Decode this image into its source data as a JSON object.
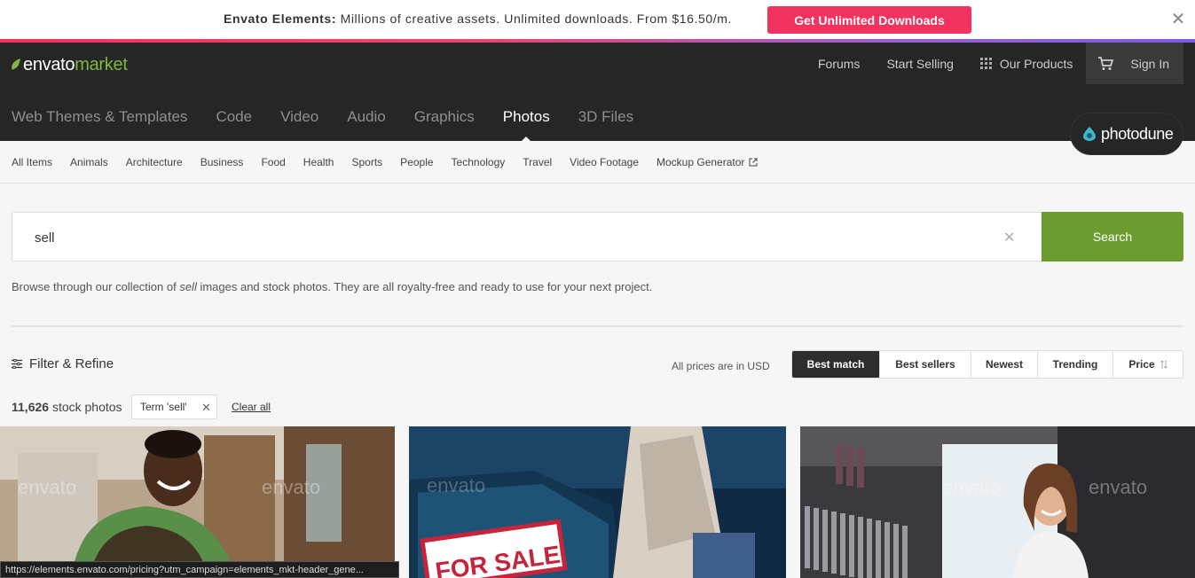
{
  "promo": {
    "brand": "Envato Elements:",
    "message": " Millions of creative assets. Unlimited downloads. From $16.50/m.",
    "cta": "Get Unlimited Downloads",
    "close": "✕"
  },
  "header": {
    "logo_envato": "envato",
    "logo_market": "market",
    "links": {
      "forums": "Forums",
      "start_selling": "Start Selling",
      "our_products": "Our Products",
      "sign_in": "Sign In"
    },
    "categories": [
      "Web Themes & Templates",
      "Code",
      "Video",
      "Audio",
      "Graphics",
      "Photos",
      "3D Files"
    ],
    "active_category": "Photos",
    "site_badge": "photodune"
  },
  "subcategories": [
    "All Items",
    "Animals",
    "Architecture",
    "Business",
    "Food",
    "Health",
    "Sports",
    "People",
    "Technology",
    "Travel",
    "Video Footage",
    "Mockup Generator"
  ],
  "search": {
    "value": "sell",
    "clear": "✕",
    "button": "Search",
    "browse_pre": "Browse through our collection of ",
    "browse_term": "sell",
    "browse_post": " images and stock photos. They are all royalty-free and ready to use for your next project."
  },
  "filter": {
    "label": "Filter & Refine",
    "prices_note": "All prices are in USD",
    "sorts": [
      "Best match",
      "Best sellers",
      "Newest",
      "Trending",
      "Price"
    ],
    "active_sort": "Best match"
  },
  "results": {
    "count": "11,626",
    "count_label": " stock photos",
    "term_tag": "Term 'sell'",
    "term_remove": "✕",
    "clear_all": "Clear all"
  },
  "photos": {
    "watermark": "envato",
    "sign_text": "FOR SALE"
  },
  "status_bar": "https://elements.envato.com/pricing?utm_campaign=elements_mkt-header_gene...",
  "colors": {
    "promo_cta": "#f2335f",
    "header_bg": "#262626",
    "brand_green": "#82b541",
    "search_button": "#6c9b30",
    "active_sort": "#2d2d2d"
  }
}
